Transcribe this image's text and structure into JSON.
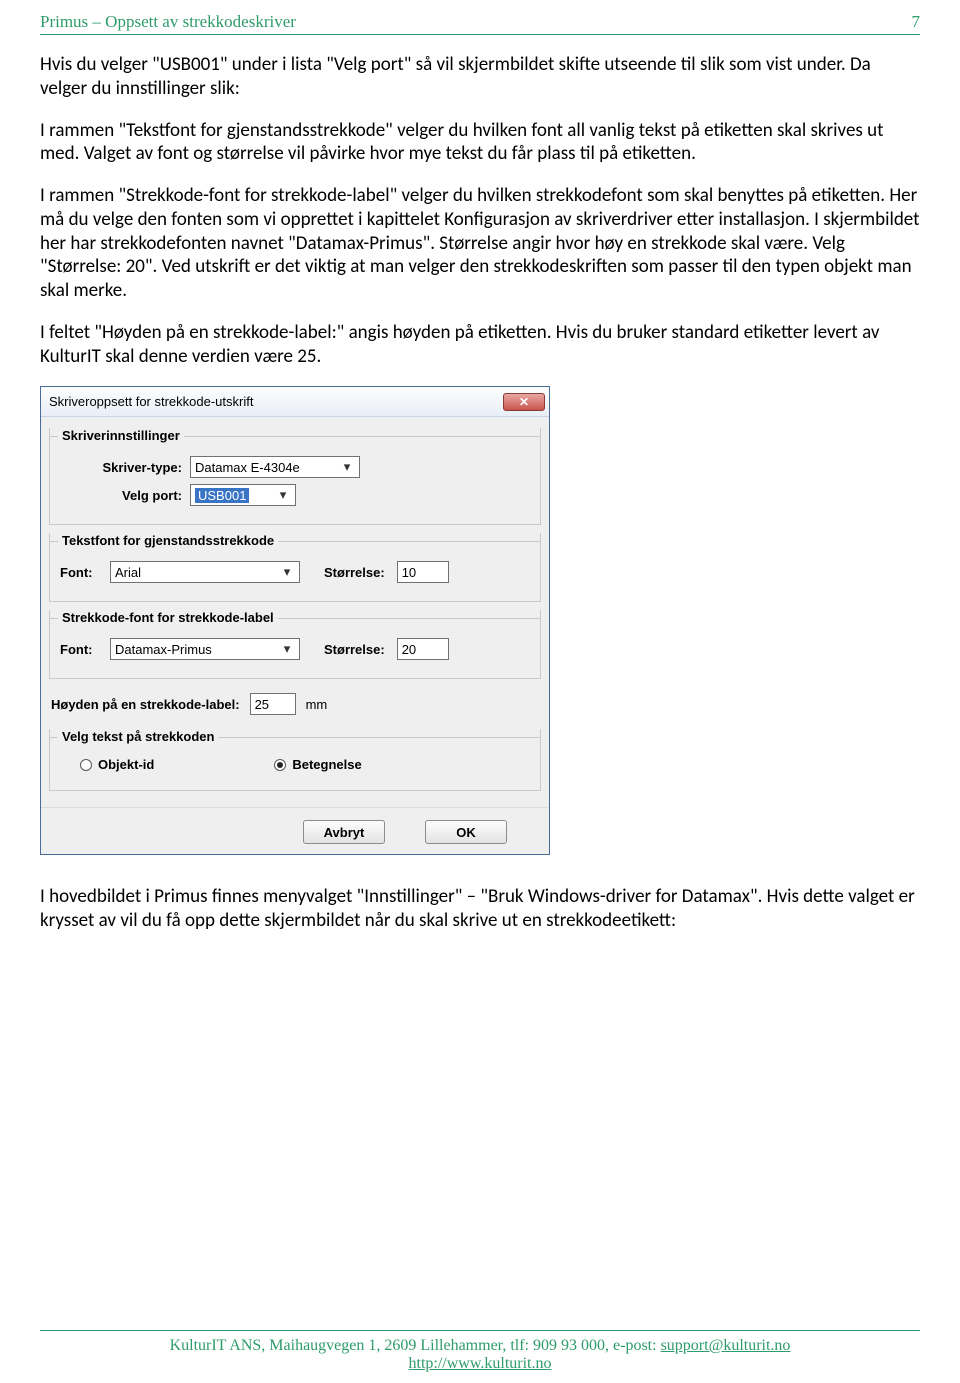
{
  "header": {
    "title": "Primus – Oppsett av strekkodeskriver",
    "page_no": "7"
  },
  "paragraphs": {
    "p1": "Hvis du velger \"USB001\" under i lista \"Velg port\" så vil skjermbildet skifte utseende til slik som vist under. Da velger du innstillinger slik:",
    "p2": "I rammen \"Tekstfont for gjenstandsstrekkode\" velger du hvilken font all vanlig tekst på etiketten skal skrives ut med. Valget av font og størrelse vil påvirke hvor mye tekst du får plass til på etiketten.",
    "p3": "I rammen \"Strekkode-font for strekkode-label\" velger du hvilken strekkodefont som skal benyttes på etiketten. Her må du velge den fonten som vi opprettet i kapittelet Konfigurasjon av skriverdriver etter installasjon. I skjermbildet her har strekkodefonten navnet \"Datamax-Primus\". Størrelse angir hvor høy en strekkode skal være. Velg \"Størrelse: 20\". Ved utskrift er det viktig at man velger den strekkodeskriften som passer til den typen objekt man skal merke.",
    "p4": "I feltet \"Høyden på en strekkode-label:\" angis høyden på etiketten. Hvis du bruker standard etiketter levert av KulturIT skal denne verdien være 25.",
    "p5": "I hovedbildet i Primus finnes menyvalget \"Innstillinger\" – \"Bruk Windows-driver for Datamax\". Hvis dette valget er krysset av vil du få opp dette skjermbildet når du skal skrive ut en strekkodeetikett:"
  },
  "dialog": {
    "title": "Skriveroppsett for strekkode-utskrift",
    "close_glyph": "✕",
    "group1": {
      "legend": "Skriverinnstillinger",
      "printer_type_label": "Skriver-type:",
      "printer_type_value": "Datamax E-4304e",
      "port_label": "Velg port:",
      "port_value": "USB001"
    },
    "group2": {
      "legend": "Tekstfont for gjenstandsstrekkode",
      "font_label": "Font:",
      "font_value": "Arial",
      "size_label": "Størrelse:",
      "size_value": "10"
    },
    "group3": {
      "legend": "Strekkode-font for strekkode-label",
      "font_label": "Font:",
      "font_value": "Datamax-Primus",
      "size_label": "Størrelse:",
      "size_value": "20"
    },
    "height_label": "Høyden på en strekkode-label:",
    "height_value": "25",
    "height_unit": "mm",
    "group4": {
      "legend": "Velg tekst på strekkoden",
      "opt1": "Objekt-id",
      "opt2": "Betegnelse"
    },
    "cancel": "Avbryt",
    "ok": "OK"
  },
  "footer": {
    "line1_pre": "KulturIT ANS, Maihaugvegen 1, 2609 Lillehammer, tlf: 909 93 000, e-post: ",
    "email": "support@kulturit.no",
    "url": "http://www.kulturit.no"
  }
}
